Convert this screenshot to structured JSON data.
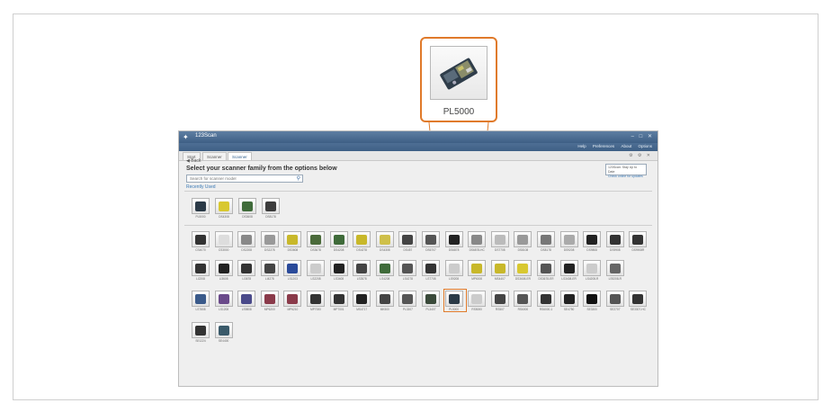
{
  "callout": {
    "model": "PL5000"
  },
  "window": {
    "title": "123Scan",
    "menus": [
      "Help",
      "Preferences",
      "About",
      "Options"
    ],
    "tabs": [
      "Start",
      "Scanner",
      "Scanner"
    ]
  },
  "page": {
    "back_label": "Back",
    "heading": "Select your scanner family from the options below",
    "search_placeholder": "Search for scanner model",
    "recent_label": "Recently Used",
    "updates_title": "123Scan: Stay Up to Date",
    "updates_link": "Check online for updates"
  },
  "recent_scanners": [
    {
      "label": "PL5000",
      "color": "#2b3a47"
    },
    {
      "label": "DS4308",
      "color": "#d8c830"
    },
    {
      "label": "DS3608",
      "color": "#3f6b3a"
    },
    {
      "label": "DS8178",
      "color": "#3c3c3c"
    }
  ],
  "scanners": [
    [
      {
        "label": "CS4070",
        "color": "#333"
      },
      {
        "label": "CS3000",
        "color": "#ddd"
      },
      {
        "label": "DS2208",
        "color": "#888"
      },
      {
        "label": "DS2278",
        "color": "#999"
      },
      {
        "label": "DS3608",
        "color": "#c8b82a"
      },
      {
        "label": "DS3678",
        "color": "#4a6a3a"
      },
      {
        "label": "DS4208",
        "color": "#3f6b3a"
      },
      {
        "label": "DS4278",
        "color": "#c8b82a"
      },
      {
        "label": "DS4308",
        "color": "#cfc04a"
      },
      {
        "label": "DS457",
        "color": "#444"
      },
      {
        "label": "DS6707",
        "color": "#555"
      },
      {
        "label": "DS6878",
        "color": "#222"
      },
      {
        "label": "DS6878-HC",
        "color": "#888"
      },
      {
        "label": "DS7708",
        "color": "#bbb"
      },
      {
        "label": "DS8108",
        "color": "#999"
      },
      {
        "label": "DS8178",
        "color": "#777"
      },
      {
        "label": "DS9208",
        "color": "#aaa"
      },
      {
        "label": "DS9808",
        "color": "#222"
      },
      {
        "label": "DS9908",
        "color": "#333"
      },
      {
        "label": "DS9908R",
        "color": "#333"
      }
    ],
    [
      {
        "label": "LI2208",
        "color": "#333"
      },
      {
        "label": "LI3608",
        "color": "#222"
      },
      {
        "label": "LI3678",
        "color": "#333"
      },
      {
        "label": "LI4278",
        "color": "#444"
      },
      {
        "label": "LS1203",
        "color": "#2a4a9a"
      },
      {
        "label": "LS2208",
        "color": "#ccc"
      },
      {
        "label": "LS3408",
        "color": "#222"
      },
      {
        "label": "LS3578",
        "color": "#444"
      },
      {
        "label": "LS4208",
        "color": "#3f6b3a"
      },
      {
        "label": "LS4278",
        "color": "#555"
      },
      {
        "label": "LS7708",
        "color": "#333"
      },
      {
        "label": "LS9208",
        "color": "#ccc"
      },
      {
        "label": "MP6000",
        "color": "#c8b82a"
      },
      {
        "label": "MS4407",
        "color": "#c8b82a"
      },
      {
        "label": "DS3608-ER",
        "color": "#d8c830"
      },
      {
        "label": "DS3678-ER",
        "color": "#555"
      },
      {
        "label": "LS3408-ER",
        "color": "#222"
      },
      {
        "label": "LS4208-R",
        "color": "#ccc"
      },
      {
        "label": "LS9208-R",
        "color": "#666"
      }
    ],
    [
      {
        "label": "LS7808",
        "color": "#3a5a8a"
      },
      {
        "label": "LS1208",
        "color": "#6a4a8a"
      },
      {
        "label": "LS9808",
        "color": "#4a4a8a"
      },
      {
        "label": "MP6200",
        "color": "#8a3a4a"
      },
      {
        "label": "MP6210",
        "color": "#8a3a4a"
      },
      {
        "label": "MP7000",
        "color": "#333"
      },
      {
        "label": "MP7001",
        "color": "#333"
      },
      {
        "label": "MS4717",
        "color": "#222"
      },
      {
        "label": "MK500",
        "color": "#444"
      },
      {
        "label": "PL3307",
        "color": "#555"
      },
      {
        "label": "PL3407",
        "color": "#3a4a3a"
      },
      {
        "label": "PL5000",
        "color": "#2b3a47"
      },
      {
        "label": "RS5000",
        "color": "#ccc"
      },
      {
        "label": "RS507",
        "color": "#444"
      },
      {
        "label": "RS6000",
        "color": "#555"
      },
      {
        "label": "RS6000-1",
        "color": "#333"
      },
      {
        "label": "SE4750",
        "color": "#222"
      },
      {
        "label": "SE3300",
        "color": "#111"
      },
      {
        "label": "SE2707",
        "color": "#555"
      },
      {
        "label": "SE3307-HC",
        "color": "#333"
      }
    ],
    [
      {
        "label": "SE1224",
        "color": "#333"
      },
      {
        "label": "SE4400",
        "color": "#3a5a6a"
      }
    ]
  ]
}
